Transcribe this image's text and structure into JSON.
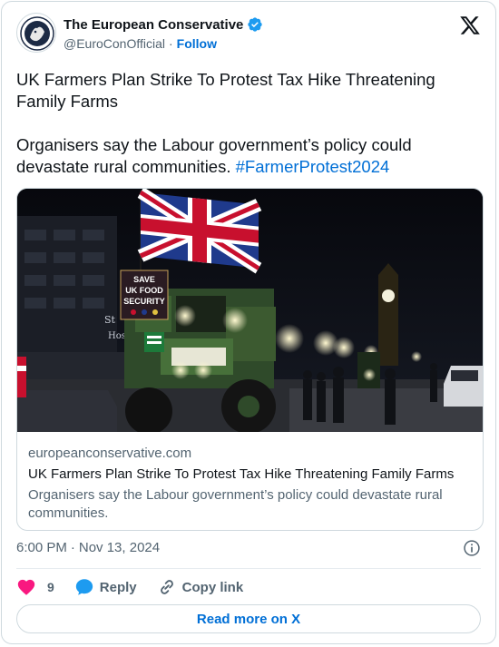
{
  "account": {
    "display_name": "The European Conservative",
    "handle": "@EuroConOfficial",
    "separator": "·",
    "follow_label": "Follow"
  },
  "tweet": {
    "line1": "UK Farmers Plan Strike To Protest Tax Hike Threatening Family Farms",
    "line2_text": "Organisers say the Labour government’s policy could devastate rural communities. ",
    "hashtag": "#FarmerProtest2024",
    "timestamp_time": "6:00 PM",
    "timestamp_sep": "·",
    "timestamp_date": "Nov 13, 2024"
  },
  "link_card": {
    "domain": "europeanconservative.com",
    "title": "UK Farmers Plan Strike To Protest Tax Hike Threatening Family Farms",
    "description": "Organisers say the Labour government’s policy could devastate rural communities.",
    "photo": {
      "sign_line1": "SAVE",
      "sign_line2": "UK FOOD",
      "sign_line3": "SECURITY"
    }
  },
  "actions": {
    "like_count": "9",
    "reply_label": "Reply",
    "copy_link_label": "Copy link"
  },
  "read_more_label": "Read more on X",
  "colors": {
    "accent": "#006fd6",
    "verified": "#1d9bf0",
    "like": "#f91880",
    "muted": "#536471",
    "border": "#cfd9de"
  },
  "icons": [
    "avatar-logo",
    "verified-badge-icon",
    "x-logo-icon",
    "info-icon",
    "heart-icon",
    "reply-bubble-icon",
    "link-icon"
  ]
}
